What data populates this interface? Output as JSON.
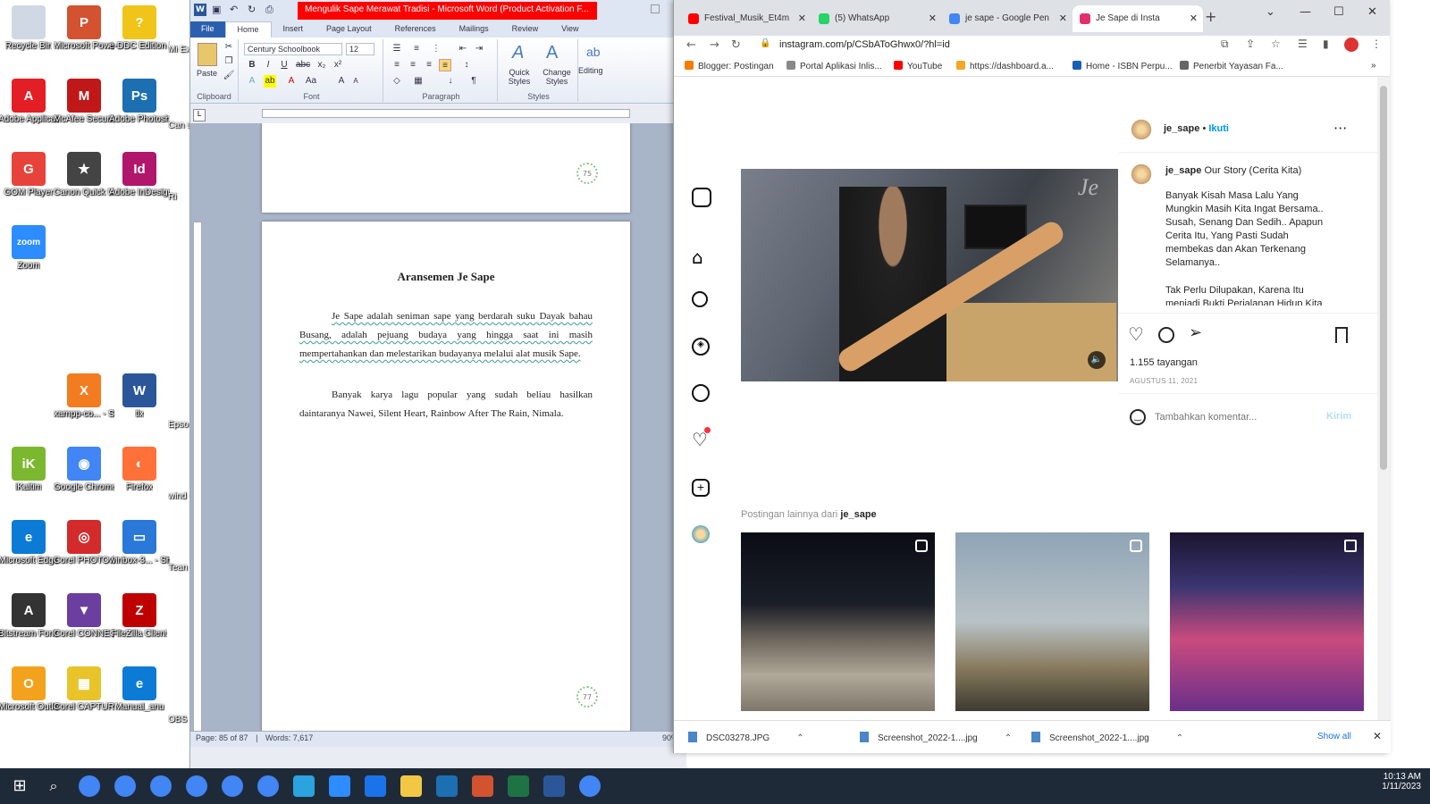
{
  "desktop": {
    "icons": [
      {
        "label": "Recycle Bin",
        "color": "#cfd8e3",
        "glyph": ""
      },
      {
        "label": "Microsoft PowerPoi...",
        "color": "#d35230",
        "glyph": "P"
      },
      {
        "label": "e-DDC Edition 23",
        "color": "#f0c419",
        "glyph": "?"
      },
      {
        "label": "Adobe Applicati...",
        "color": "#e31e24",
        "glyph": "A"
      },
      {
        "label": "McAfee Security Sc...",
        "color": "#c01818",
        "glyph": "M"
      },
      {
        "label": "Adobe Photosh...",
        "color": "#1c6fb0",
        "glyph": "Ps"
      },
      {
        "label": "GOM Player",
        "color": "#e8433a",
        "glyph": "G"
      },
      {
        "label": "Canon Quick Menu",
        "color": "#444444",
        "glyph": "★"
      },
      {
        "label": "Adobe InDesign CS6",
        "color": "#b0166b",
        "glyph": "Id"
      },
      {
        "label": "Zoom",
        "color": "#2d8cff",
        "glyph": "zoom"
      },
      {
        "label": "xampp-co... - Shortcut",
        "color": "#f47c20",
        "glyph": "X"
      },
      {
        "label": "tlx",
        "color": "#2b579a",
        "glyph": "W"
      },
      {
        "label": "iKaltim",
        "color": "#7cb82f",
        "glyph": "iK"
      },
      {
        "label": "Google Chrome",
        "color": "#4285f4",
        "glyph": "◉"
      },
      {
        "label": "Firefox",
        "color": "#ff7139",
        "glyph": "◐"
      },
      {
        "label": "Microsoft Edge",
        "color": "#0c7bd6",
        "glyph": "e"
      },
      {
        "label": "Corel PHOTO-PAI...",
        "color": "#d32b2b",
        "glyph": "◎"
      },
      {
        "label": "winbox-3... - Shortcut",
        "color": "#2a79d8",
        "glyph": "▭"
      },
      {
        "label": "Bitstream Font Na...",
        "color": "#333333",
        "glyph": "A"
      },
      {
        "label": "Corel CONNECT ...",
        "color": "#6a3fa0",
        "glyph": "▼"
      },
      {
        "label": "FileZilla Client",
        "color": "#bf0000",
        "glyph": "Z"
      },
      {
        "label": "Microsoft Outlook 2010",
        "color": "#f3a21d",
        "glyph": "O"
      },
      {
        "label": "Corel CAPTURE ...",
        "color": "#e8c32a",
        "glyph": "▦"
      },
      {
        "label": "Manual_anu",
        "color": "#0c7bd6",
        "glyph": "e"
      }
    ],
    "partial": [
      "Mi Ex",
      "Can sere",
      "Ri",
      "Epso Cor",
      "wind - S",
      "Tean",
      "OBS"
    ]
  },
  "word": {
    "title": "Mengulik Sape Merawat Tradisi - Microsoft Word (Product Activation F...",
    "tabs": {
      "file": "File",
      "home": "Home",
      "insert": "Insert",
      "layout": "Page Layout",
      "refs": "References",
      "mailings": "Mailings",
      "review": "Review",
      "view": "View"
    },
    "font_name": "Century Schoolbook",
    "font_size": "12",
    "groups": {
      "clipboard": "Clipboard",
      "font": "Font",
      "paragraph": "Paragraph",
      "styles": "Styles"
    },
    "paste": "Paste",
    "quick_styles": "Quick Styles",
    "change_styles": "Change Styles",
    "editing": "Editing",
    "page_top_num": "75",
    "page_num": "77",
    "heading": "Aransemen Je Sape",
    "para1": "Je Sape adalah seniman sape yang berdarah suku Dayak bahau Busang, adalah pejuang budaya yang hingga saat ini masih mempertahankan dan melestarikan budayanya melalui alat musik Sape.",
    "para2": "Banyak karya lagu popular yang sudah beliau hasilkan daintaranya Nawei, Silent Heart, Rainbow After The Rain, Nimala.",
    "status_page": "Page: 85 of 87",
    "status_words": "Words: 7,617",
    "zoom": "90%"
  },
  "chrome": {
    "tabs": [
      {
        "label": "Festival_Musik_Et4m",
        "icon_color": "#ff0000"
      },
      {
        "label": "(5) WhatsApp",
        "icon_color": "#25d366"
      },
      {
        "label": "je sape - Google Pen",
        "icon_color": "#4285f4"
      },
      {
        "label": "Je Sape di Insta",
        "icon_color": "#e1306c"
      }
    ],
    "url": "instagram.com/p/CSbAToGhwx0/?hl=id",
    "bookmarks": [
      {
        "label": "Blogger: Postingan",
        "color": "#f57d00"
      },
      {
        "label": "Portal Aplikasi Inlis...",
        "color": "#888888"
      },
      {
        "label": "YouTube",
        "color": "#ff0000"
      },
      {
        "label": "https://dashboard.a...",
        "color": "#f5a623"
      },
      {
        "label": "Home - ISBN Perpu...",
        "color": "#1a5fb4"
      },
      {
        "label": "Penerbit Yayasan Fa...",
        "color": "#666666"
      }
    ],
    "downloads": [
      "DSC03278.JPG",
      "Screenshot_2022-1....jpg",
      "Screenshot_2022-1....jpg"
    ],
    "show_all": "Show all"
  },
  "instagram": {
    "username": "je_sape",
    "follow": "Ikuti",
    "caption_title": "Our Story (Cerita Kita)",
    "caption_p1": "Banyak Kisah Masa Lalu Yang Mungkin Masih Kita Ingat Bersama.. Susah, Senang Dan Sedih.. Apapun Cerita Itu, Yang Pasti Sudah membekas dan Akan Terkenang Selamanya..",
    "caption_p2": "Tak Perlu Dilupakan, Karena Itu menjadi Bukti Perjalanan Hidup Kita Sebagai Pemuda Pemudi...",
    "views": "1.155 tayangan",
    "date": "AGUSTUS 11, 2021",
    "comment_placeholder": "Tambahkan komentar...",
    "post_button": "Kirim",
    "more_posts": "Postingan lainnya dari",
    "video_watermark": "Je"
  },
  "taskbar": {
    "time": "10:13 AM",
    "date": "1/11/2023"
  }
}
